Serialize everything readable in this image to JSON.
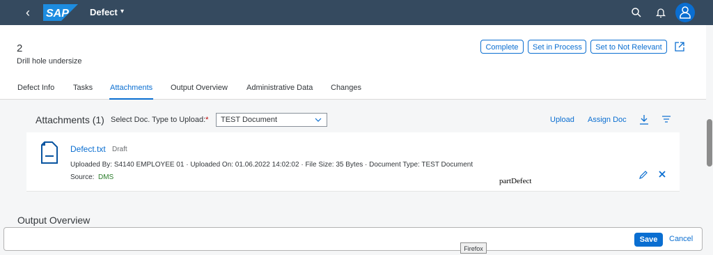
{
  "shell": {
    "logo": "SAP",
    "app_title": "Defect",
    "caret": "▾"
  },
  "header": {
    "object_id": "2",
    "subtitle": "Drill hole undersize"
  },
  "actions": {
    "complete": "Complete",
    "set_in_process": "Set in Process",
    "set_not_relevant": "Set to Not Relevant"
  },
  "tabs": [
    {
      "label": "Defect Info"
    },
    {
      "label": "Tasks"
    },
    {
      "label": "Attachments"
    },
    {
      "label": "Output Overview"
    },
    {
      "label": "Administrative Data"
    },
    {
      "label": "Changes"
    }
  ],
  "active_tab": "Attachments",
  "attachments": {
    "title": "Attachments (1)",
    "doc_type_label": "Select Doc. Type to Upload:",
    "required_marker": "*",
    "doc_type_value": "TEST Document",
    "upload": "Upload",
    "assign_doc": "Assign Doc",
    "items": [
      {
        "name": "Defect.txt",
        "status": "Draft",
        "meta": "Uploaded By: S4140 EMPLOYEE 01 · Uploaded On: 01.06.2022 14:02:02 · File Size: 35 Bytes · Document Type: TEST Document",
        "source_label": "Source:",
        "source_value": "DMS"
      }
    ]
  },
  "overlay_text": "partDefect",
  "output_overview": {
    "title": "Output Overview"
  },
  "footer": {
    "save": "Save",
    "cancel": "Cancel"
  },
  "tooltip": "Firefox",
  "colors": {
    "shell": "#354a5f",
    "accent": "#0a6ed1",
    "source_green": "#2b7d2b",
    "required": "#bb0000"
  }
}
